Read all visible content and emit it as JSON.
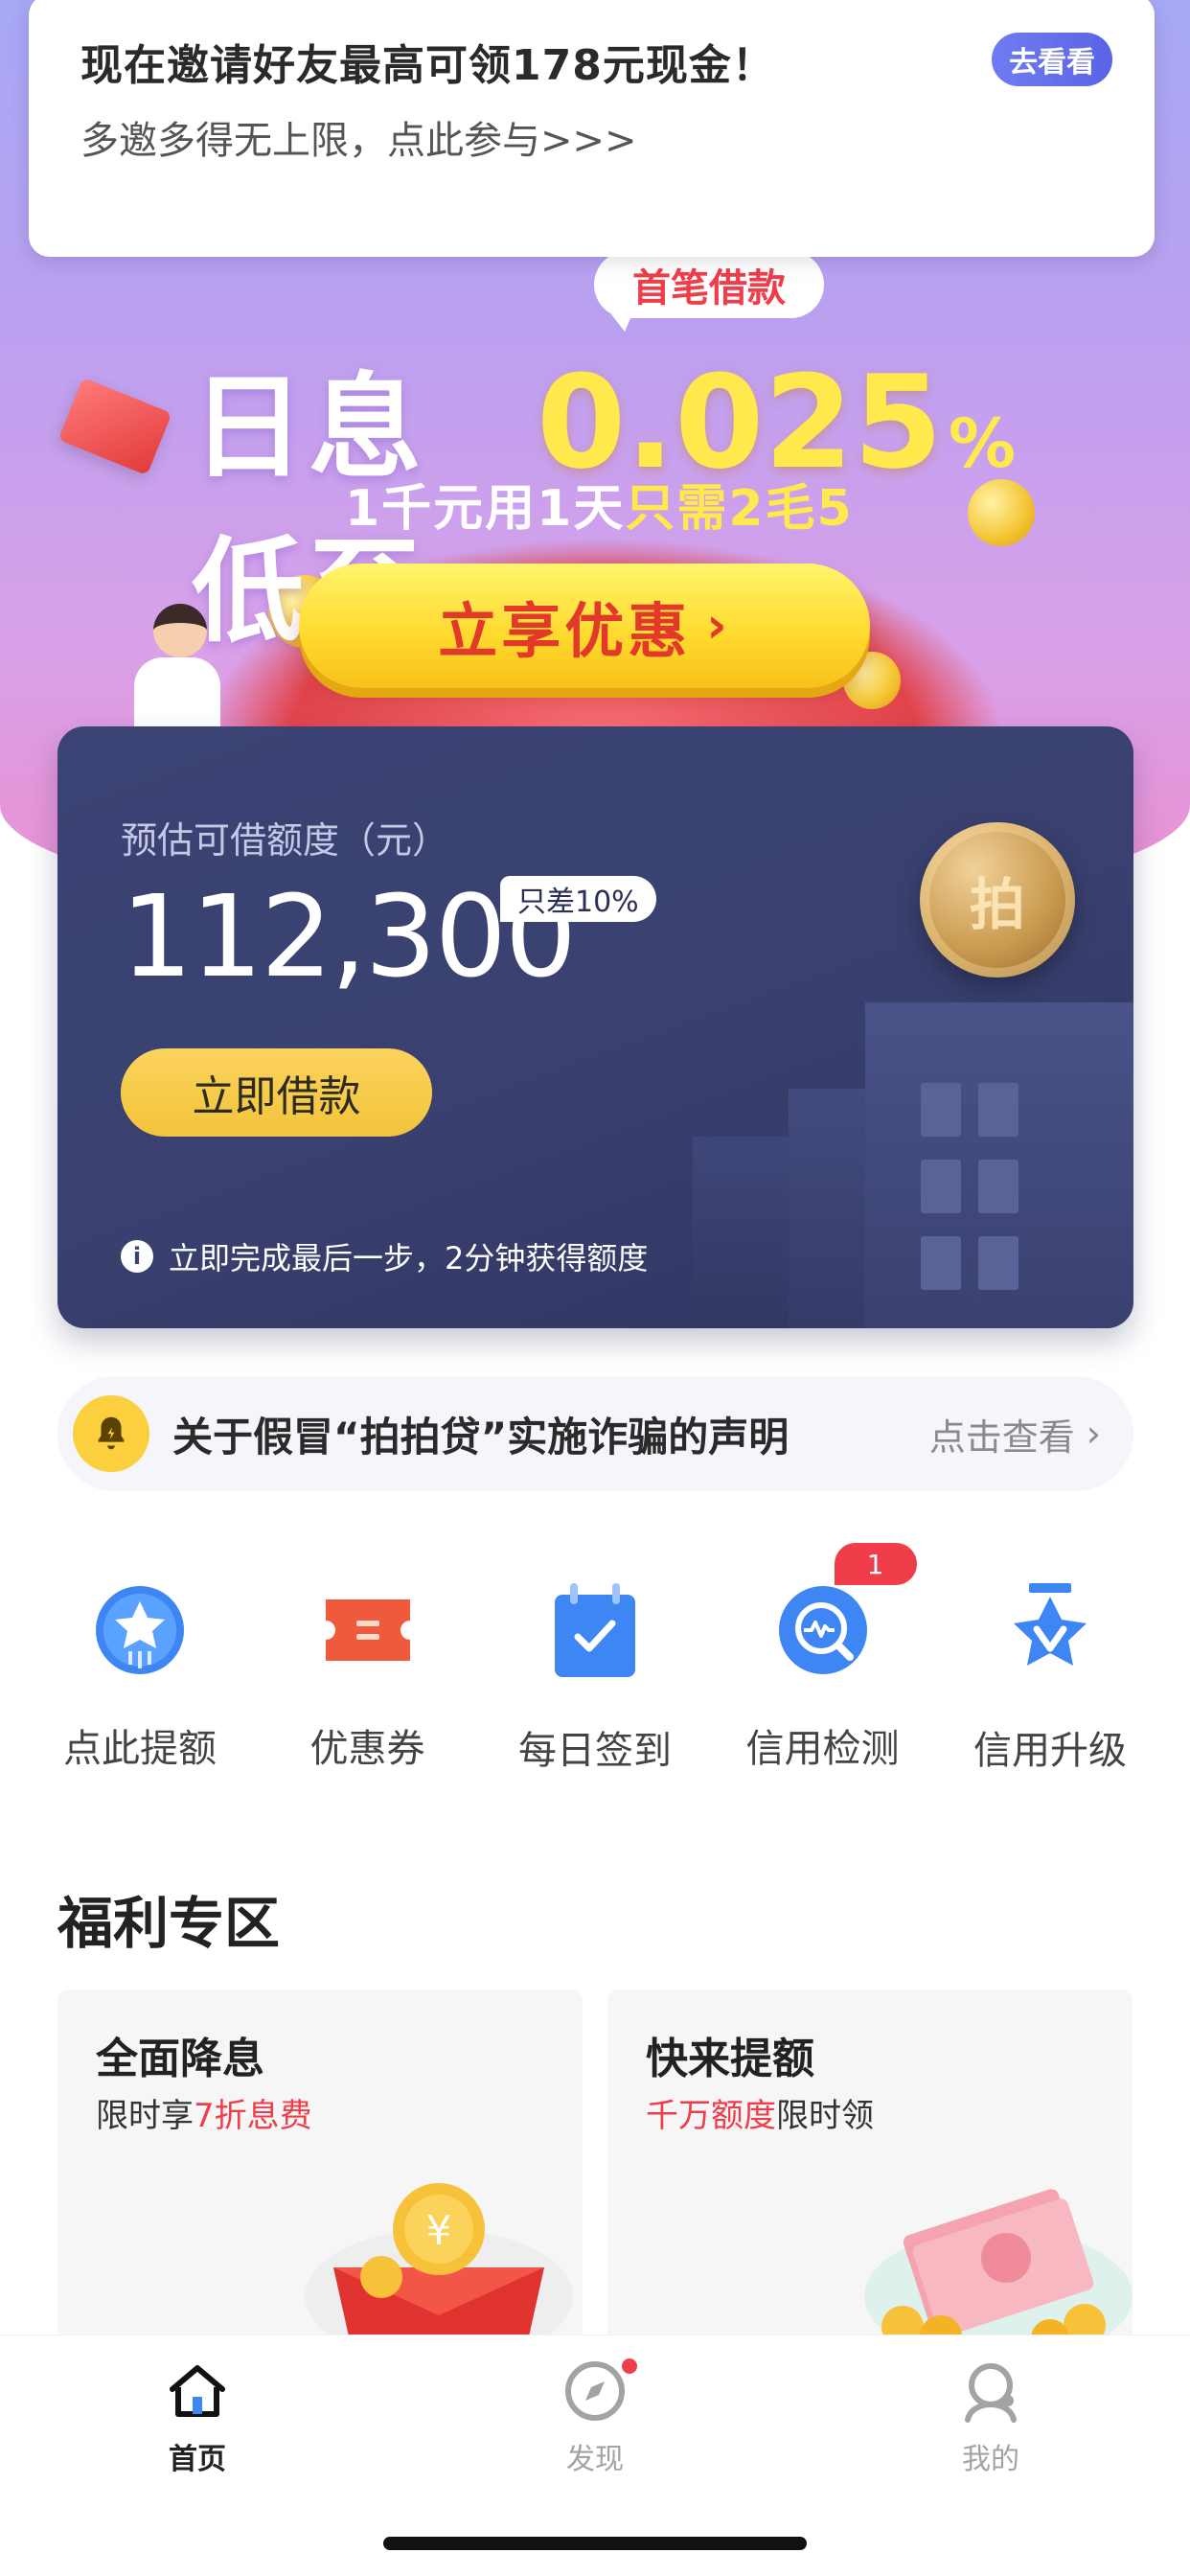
{
  "notice": {
    "title": "现在邀请好友最高可领178元现金！",
    "subtitle": "多邀多得无上限，点此参与>>>",
    "badge_label": "去看看"
  },
  "hero": {
    "first_loan_tag": "首笔借款",
    "rate_label": "日息低至",
    "rate_value": "0.025",
    "rate_unit": "%",
    "price_prefix": "1千元用1天",
    "price_highlight": "只需2毛5",
    "cta_label": "立享优惠",
    "cta_arrow": "›"
  },
  "credit_card": {
    "limit_label": "预估可借额度（元）",
    "amount": "112,300",
    "gap_tag": "只差10%",
    "borrow_button": "立即借款",
    "hint": "立即完成最后一步，2分钟获得额度",
    "coin_char": "拍"
  },
  "fraud_notice": {
    "text": "关于假冒“拍拍贷”实施诈骗的声明",
    "link_label": "点击查看"
  },
  "quick_actions": [
    {
      "label": "点此提额",
      "icon": "star-badge-icon"
    },
    {
      "label": "优惠券",
      "icon": "coupon-icon"
    },
    {
      "label": "每日签到",
      "icon": "calendar-check-icon"
    },
    {
      "label": "信用检测",
      "icon": "credit-check-icon",
      "badge": "1"
    },
    {
      "label": "信用升级",
      "icon": "medal-icon"
    }
  ],
  "welfare": {
    "title": "福利专区",
    "cards": [
      {
        "title": "全面降息",
        "sub_prefix": "限时享",
        "sub_highlight": "7折息费",
        "sub_suffix": ""
      },
      {
        "title": "快来提额",
        "sub_prefix": "",
        "sub_highlight": "千万额度",
        "sub_suffix": "限时领"
      }
    ]
  },
  "tabbar": {
    "tabs": [
      {
        "label": "首页",
        "icon": "home-icon",
        "active": true
      },
      {
        "label": "发现",
        "icon": "compass-icon",
        "active": false
      },
      {
        "label": "我的",
        "icon": "user-icon",
        "active": false
      }
    ]
  },
  "colors": {
    "accent_red": "#ef3d4a",
    "accent_yellow": "#f3c33b",
    "card_navy": "#3a4170",
    "hero_purple": "#bba0f0"
  }
}
